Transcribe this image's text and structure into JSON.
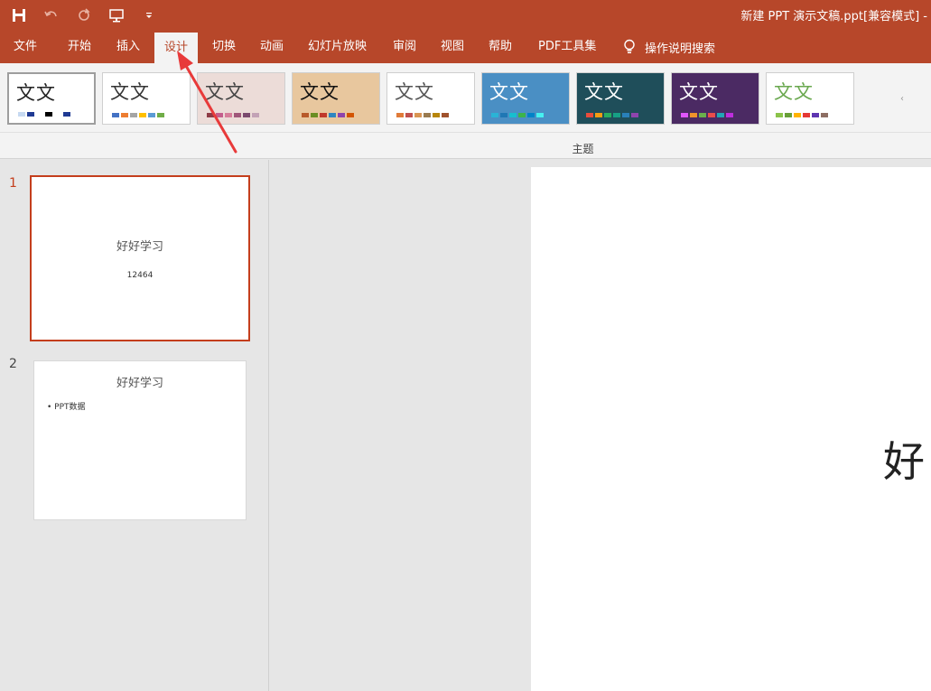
{
  "window": {
    "title": "新建 PPT 演示文稿.ppt[兼容模式] -"
  },
  "quick_access": [
    "save-icon",
    "undo-icon",
    "redo-icon",
    "start-from-beginning-icon",
    "customize-qat-icon"
  ],
  "ribbon": {
    "tabs": [
      {
        "label": "文件"
      },
      {
        "label": "开始"
      },
      {
        "label": "插入"
      },
      {
        "label": "设计"
      },
      {
        "label": "切换"
      },
      {
        "label": "动画"
      },
      {
        "label": "幻灯片放映"
      },
      {
        "label": "审阅"
      },
      {
        "label": "视图"
      },
      {
        "label": "帮助"
      },
      {
        "label": "PDF工具集"
      }
    ],
    "active_tab": "设计",
    "tell_me": "操作说明搜索",
    "group_label": "主题",
    "themes": [
      {
        "text": "文文",
        "bg": "#ffffff",
        "fg": "#222222",
        "swatches": [
          "#c6d9f1",
          "#1f3a93",
          "#ffffff",
          "#000000",
          "#ffffff",
          "#1f3a93"
        ]
      },
      {
        "text": "文文",
        "bg": "#ffffff",
        "fg": "#333333",
        "swatches": [
          "#4472c4",
          "#ed7d31",
          "#a5a5a5",
          "#ffc000",
          "#5b9bd5",
          "#70ad47"
        ]
      },
      {
        "text": "文文",
        "bg": "#ecdcd8",
        "fg": "#444444",
        "swatches": [
          "#8e3b46",
          "#c45e8c",
          "#d67e9a",
          "#a0577a",
          "#7b4a6e",
          "#c3a2b6"
        ]
      },
      {
        "text": "文文",
        "bg": "#e8c79e",
        "fg": "#111111",
        "swatches": [
          "#b85a2a",
          "#6b8e23",
          "#c0392b",
          "#2e86c1",
          "#8e44ad",
          "#d35400"
        ]
      },
      {
        "text": "文文",
        "bg": "#ffffff",
        "fg": "#555555",
        "swatches": [
          "#e07b39",
          "#c0504d",
          "#d99552",
          "#9a7b4f",
          "#b8860b",
          "#a0522d"
        ]
      },
      {
        "text": "文文",
        "bg": "#4a8fc4",
        "fg": "#ffffff",
        "swatches": [
          "#2ab3d6",
          "#1f77b4",
          "#17becf",
          "#3cb44b",
          "#0082c8",
          "#46f0f0"
        ]
      },
      {
        "text": "文文",
        "bg": "#1f4e5a",
        "fg": "#ffffff",
        "swatches": [
          "#e74c3c",
          "#f39c12",
          "#27ae60",
          "#16a085",
          "#2980b9",
          "#8e44ad"
        ]
      },
      {
        "text": "文文",
        "bg": "#4b2a63",
        "fg": "#ffffff",
        "swatches": [
          "#e056fd",
          "#f0932b",
          "#6ab04c",
          "#eb4d4b",
          "#22a6b3",
          "#be2edd"
        ]
      },
      {
        "text": "文文",
        "bg": "#ffffff",
        "fg": "#6aa84f",
        "swatches": [
          "#8bc34a",
          "#689f38",
          "#ffb300",
          "#e53935",
          "#5e35b1",
          "#8d6e63"
        ]
      }
    ]
  },
  "slides": [
    {
      "number": "1",
      "title": "好好学习",
      "subtitle": "12464"
    },
    {
      "number": "2",
      "title": "好好学习",
      "bullet": "• PPT数据"
    }
  ],
  "editor": {
    "visible_title": "好"
  },
  "colors": {
    "accent": "#b7472a",
    "selected_slide": "#c43e1c",
    "annotation_arrow": "#e83a3a"
  }
}
